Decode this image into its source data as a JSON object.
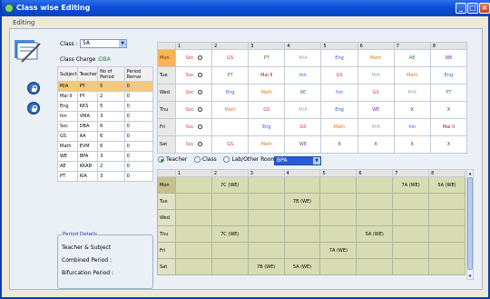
{
  "window": {
    "title": "Class wise Editing",
    "menu": "Editing"
  },
  "form": {
    "class_label": "Class :",
    "class_value": "5A",
    "charge_label": "Class Charge :",
    "charge_value": "DBA"
  },
  "subjects": {
    "headers": [
      "Subject",
      "Teacher",
      "No of Period",
      "Period Remai"
    ],
    "rows": [
      [
        "M/A",
        "PY",
        "5",
        "0"
      ],
      [
        "Mal II",
        "PY",
        "2",
        "0"
      ],
      [
        "Eng",
        "KKS",
        "5",
        "0"
      ],
      [
        "hin",
        "VMA",
        "3",
        "0"
      ],
      [
        "Soc",
        "DBA",
        "6",
        "0"
      ],
      [
        "GS",
        "AA",
        "6",
        "0"
      ],
      [
        "Math",
        "EVM",
        "6",
        "0"
      ],
      [
        "WE",
        "BPA",
        "3",
        "0"
      ],
      [
        "AE",
        "KKAB",
        "2",
        "0"
      ],
      [
        "PT",
        "KIA",
        "3",
        "0"
      ]
    ]
  },
  "period_details": {
    "title": "Period Details",
    "teacher_subject": "Teacher & Subject",
    "combined": "Combined Period :",
    "bifurcation": "Bifurcation Period :"
  },
  "timetable": {
    "periods": [
      "1",
      "2",
      "3",
      "4",
      "5",
      "6",
      "7",
      "8"
    ],
    "rows": [
      {
        "day": "Mon",
        "cells": [
          {
            "t": "Soc",
            "c": "#d33"
          },
          {
            "t": "GS",
            "c": "#d33"
          },
          {
            "t": "PT",
            "c": "#2a8a2a"
          },
          {
            "t": "M/A",
            "c": "#9aa"
          },
          {
            "t": "Eng",
            "c": "#2a5ad8"
          },
          {
            "t": "Math",
            "c": "#e07a10"
          },
          {
            "t": "AE",
            "c": "#2a8a2a"
          },
          {
            "t": "WE",
            "c": "#7a2ab0"
          }
        ]
      },
      {
        "day": "Tue",
        "cells": [
          {
            "t": "Soc",
            "c": "#d33"
          },
          {
            "t": "PT",
            "c": "#2a8a2a"
          },
          {
            "t": "Mal II",
            "c": "#8a1a1a"
          },
          {
            "t": "hin",
            "c": "#2a5ad8"
          },
          {
            "t": "GS",
            "c": "#d33"
          },
          {
            "t": "M/A",
            "c": "#9aa"
          },
          {
            "t": "Math",
            "c": "#e07a10"
          },
          {
            "t": "Eng",
            "c": "#2a5ad8"
          }
        ]
      },
      {
        "day": "Wed",
        "cells": [
          {
            "t": "Soc",
            "c": "#d33"
          },
          {
            "t": "Eng",
            "c": "#2a5ad8"
          },
          {
            "t": "Math",
            "c": "#e07a10"
          },
          {
            "t": "AE",
            "c": "#2a8a2a"
          },
          {
            "t": "hin",
            "c": "#2a5ad8"
          },
          {
            "t": "GS",
            "c": "#d33"
          },
          {
            "t": "M/A",
            "c": "#9aa"
          },
          {
            "t": "PT",
            "c": "#2a8a2a"
          }
        ]
      },
      {
        "day": "Thu",
        "cells": [
          {
            "t": "Soc",
            "c": "#d33"
          },
          {
            "t": "Math",
            "c": "#e07a10"
          },
          {
            "t": "GS",
            "c": "#d33"
          },
          {
            "t": "M/A",
            "c": "#9aa"
          },
          {
            "t": "Eng",
            "c": "#2a5ad8"
          },
          {
            "t": "WE",
            "c": "#7a2ab0"
          },
          {
            "t": "X",
            "c": "#333"
          },
          {
            "t": "X",
            "c": "#333"
          }
        ]
      },
      {
        "day": "Fri",
        "cells": [
          {
            "t": "Soc",
            "c": "#d33"
          },
          {
            "t": "",
            "c": "#333"
          },
          {
            "t": "Eng",
            "c": "#2a5ad8"
          },
          {
            "t": "GS",
            "c": "#d33"
          },
          {
            "t": "Math",
            "c": "#e07a10"
          },
          {
            "t": "M/A",
            "c": "#9aa"
          },
          {
            "t": "hin",
            "c": "#2a5ad8"
          },
          {
            "t": "Mal II",
            "c": "#8a1a1a"
          }
        ]
      },
      {
        "day": "Sat",
        "cells": [
          {
            "t": "Soc",
            "c": "#d33"
          },
          {
            "t": "GS",
            "c": "#d33"
          },
          {
            "t": "Math",
            "c": "#e07a10"
          },
          {
            "t": "WE",
            "c": "#7a2ab0"
          },
          {
            "t": "X",
            "c": "#333"
          },
          {
            "t": "X",
            "c": "#333"
          },
          {
            "t": "X",
            "c": "#333"
          },
          {
            "t": "X",
            "c": "#333"
          }
        ]
      }
    ]
  },
  "view": {
    "teacher": "Teacher",
    "class": "Class",
    "lab": "Lab/Other Rooms",
    "selected": "BPA"
  },
  "teacher_grid": {
    "periods": [
      "1",
      "2",
      "3",
      "4",
      "5",
      "6",
      "7",
      "8"
    ],
    "rows": [
      {
        "day": "Mon",
        "cells": [
          "",
          "7C (WE)",
          "",
          "",
          "",
          "",
          "7A (WE)",
          "5A (WE)"
        ]
      },
      {
        "day": "Tue",
        "cells": [
          "",
          "",
          "",
          "7B (WE)",
          "",
          "",
          "",
          ""
        ]
      },
      {
        "day": "Wed",
        "cells": [
          "",
          "",
          "",
          "",
          "",
          "",
          "",
          ""
        ]
      },
      {
        "day": "Thu",
        "cells": [
          "",
          "7C (WE)",
          "",
          "",
          "",
          "5A (WE)",
          "",
          ""
        ]
      },
      {
        "day": "Fri",
        "cells": [
          "",
          "",
          "",
          "",
          "7A (WE)",
          "",
          "",
          ""
        ]
      },
      {
        "day": "Sat",
        "cells": [
          "",
          "",
          "7B (WE)",
          "5A (WE)",
          "",
          "",
          "",
          ""
        ]
      }
    ]
  }
}
